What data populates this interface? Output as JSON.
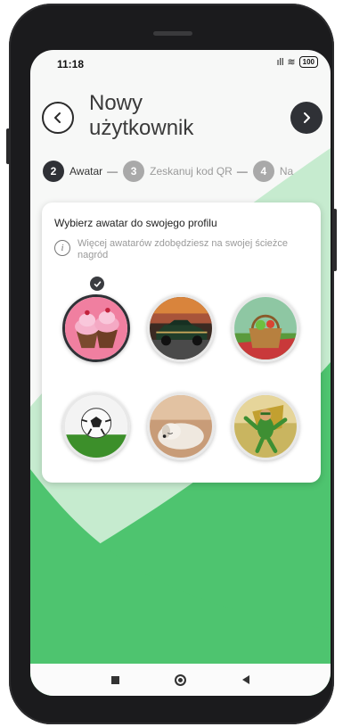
{
  "status_bar": {
    "time": "11:18",
    "signal": "ıll",
    "wifi": "≋",
    "battery": "100"
  },
  "header": {
    "title_line1": "Nowy",
    "title_line2": "użytkownik"
  },
  "steps": [
    {
      "number": "2",
      "label": "Awatar",
      "dash": "—"
    },
    {
      "number": "3",
      "label": "Zeskanuj kod QR",
      "dash": "—"
    },
    {
      "number": "4",
      "label": "Na"
    }
  ],
  "card": {
    "title": "Wybierz awatar do swojego profilu",
    "info_icon": "i",
    "info_text": "Więcej awatarów zdobędziesz na swojej ścieżce nagród"
  },
  "avatars": [
    {
      "name": "cupcakes",
      "selected": true
    },
    {
      "name": "muscle-car",
      "selected": false
    },
    {
      "name": "picnic-basket",
      "selected": false
    },
    {
      "name": "soccer-ball",
      "selected": false
    },
    {
      "name": "sleeping-dog",
      "selected": false
    },
    {
      "name": "superhero",
      "selected": false
    }
  ],
  "colors": {
    "accent_dark": "#2f3136",
    "green": "#4ec46f",
    "green_light": "#bfe8c8"
  }
}
